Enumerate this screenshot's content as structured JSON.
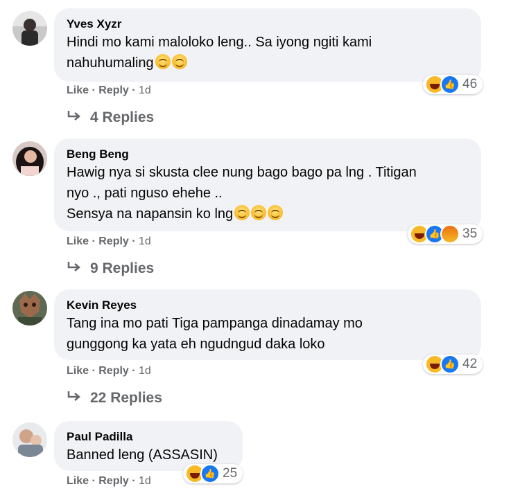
{
  "comments": [
    {
      "author": "Yves Xyzr",
      "text": "Hindi mo kami maloloko leng.. Sa iyong ngiti kami\nnahuhumaling",
      "emoji_count": 2,
      "reactions": [
        "haha",
        "like"
      ],
      "reaction_count": "46",
      "like_label": "Like",
      "reply_label": "Reply",
      "time": "1d",
      "replies_label": "4 Replies"
    },
    {
      "author": "Beng Beng",
      "text": "Hawig nya si skusta clee nung bago bago pa lng . Titigan\nnyo ., pati nguso ehehe ..\nSensya na napansin ko lng",
      "emoji_count": 3,
      "reactions": [
        "haha",
        "like",
        "angry"
      ],
      "reaction_count": "35",
      "like_label": "Like",
      "reply_label": "Reply",
      "time": "1d",
      "replies_label": "9 Replies"
    },
    {
      "author": "Kevin Reyes",
      "text": "Tang ina mo pati Tiga pampanga dinadamay mo\ngunggong ka yata eh ngudngud daka loko",
      "emoji_count": 0,
      "reactions": [
        "haha",
        "like"
      ],
      "reaction_count": "42",
      "like_label": "Like",
      "reply_label": "Reply",
      "time": "1d",
      "replies_label": "22 Replies"
    },
    {
      "author": "Paul Padilla",
      "text": "Banned leng (ASSASIN)",
      "emoji_count": 0,
      "reactions": [
        "haha",
        "like"
      ],
      "reaction_count": "25",
      "like_label": "Like",
      "reply_label": "Reply",
      "time": "1d",
      "replies_label": ""
    }
  ],
  "colors": {
    "bubble": "#f0f2f5",
    "meta": "#65676b",
    "like_blue": "#1877f2",
    "haha_yellow": "#f7b928"
  },
  "icons": {
    "reply_arrow": "reply-arrow-icon",
    "like": "like-reaction-icon",
    "haha": "haha-reaction-icon",
    "angry": "angry-reaction-icon"
  }
}
